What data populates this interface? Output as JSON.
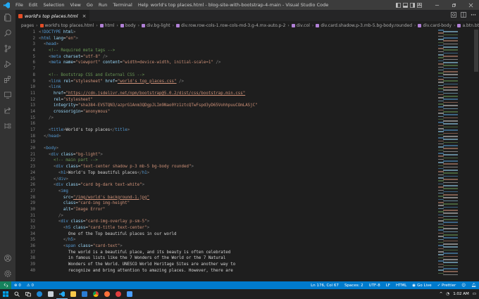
{
  "titlebar": {
    "menu": [
      "File",
      "Edit",
      "Selection",
      "View",
      "Go",
      "Run",
      "Terminal",
      "Help"
    ],
    "title": "world's top places.html - blog-site-with-bootstrap-4-main - Visual Studio Code"
  },
  "activity": {
    "source_control_badge": ""
  },
  "tab": {
    "label": "world's top places.html",
    "close": "×"
  },
  "breadcrumb": [
    "pages",
    "world's top places.html",
    "html",
    "body",
    "div.bg-light",
    "div.row.row-cols-1.row-cols-md-3.g-4.mx-auto.p-2",
    "div.col",
    "div.card.shadow.p-3.mb-5.bg-body.rounded",
    "div.card-body",
    "a.btn.btn-sm.btn-da"
  ],
  "editor": {
    "line_numbers": [
      "1",
      "2",
      "3",
      "4",
      "5",
      "6",
      "7",
      "8",
      "9",
      "10",
      "11",
      "12",
      "13",
      "14",
      "15",
      "16",
      "17",
      "18",
      "19",
      "20",
      "21",
      "22",
      "23",
      "24",
      "25",
      "26",
      "27",
      "28",
      "29",
      "30",
      "31",
      "32",
      "33",
      "34",
      "35",
      "36",
      "37",
      "38",
      "39",
      "40"
    ]
  },
  "status": {
    "errors": "⊗ 0",
    "warnings": "⚠ 0",
    "position": "Ln 176, Col 67",
    "spaces": "Spaces: 2",
    "encoding": "UTF-8",
    "eol": "LF",
    "language": "HTML",
    "golive": "Go Live",
    "prettier": "✓ Prettier"
  },
  "taskbar": {
    "time": "1:02 AM"
  },
  "colors": {
    "accent": "#007acc",
    "tag": "#569cd6",
    "attr": "#9cdcfe",
    "string": "#ce9178",
    "comment": "#6a9955"
  }
}
